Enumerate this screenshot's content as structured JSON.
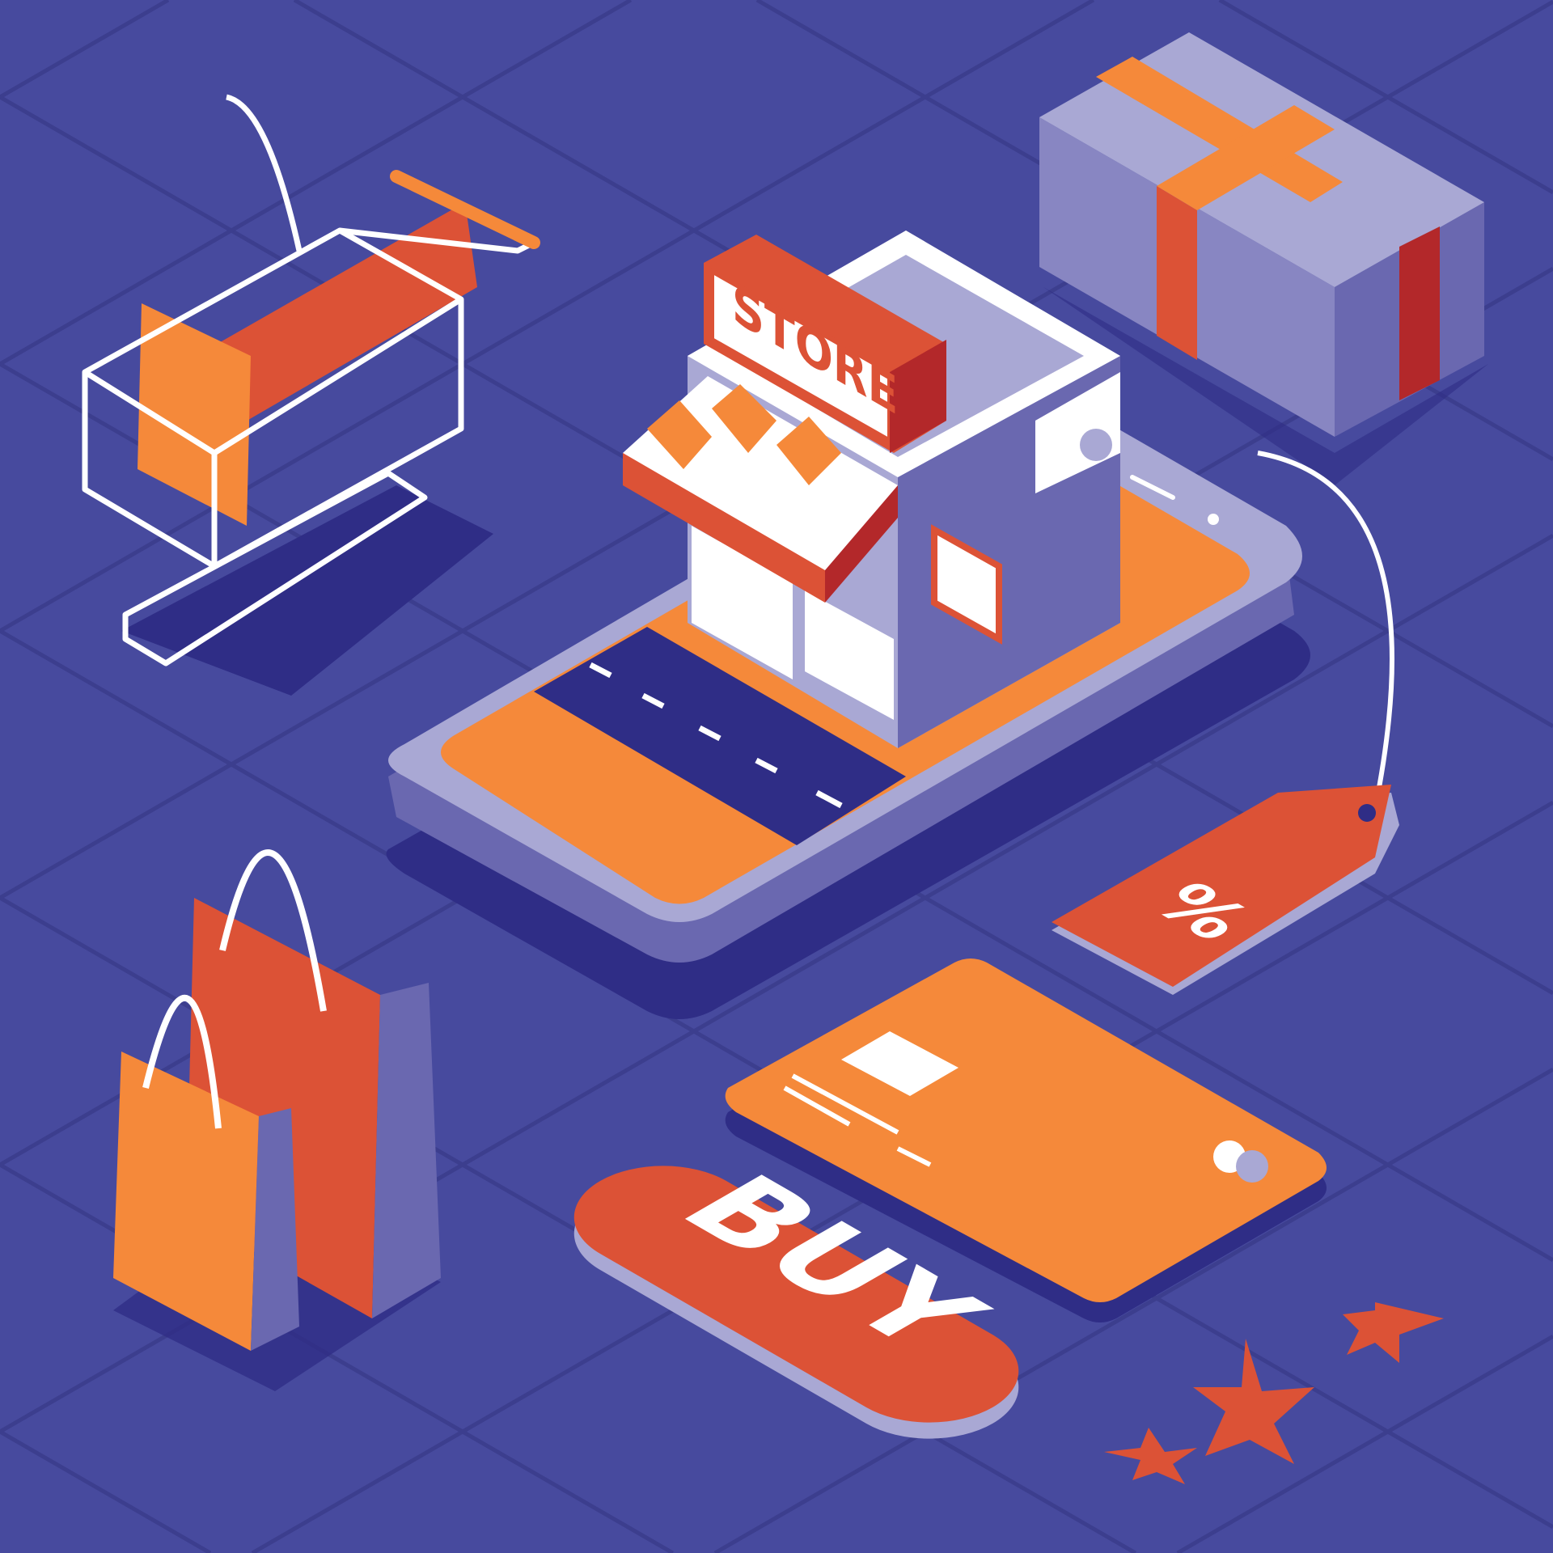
{
  "scene": {
    "store_sign": "STORE",
    "buy_button": "BUY",
    "discount_tag": "%"
  },
  "colors": {
    "background": "#474a9e",
    "grid": "#3c3e8e",
    "shadow": "#2f2d86",
    "orange": "#f5893a",
    "red_orange": "#dc5236",
    "dark_red": "#b3282a",
    "lavender": "#a9a8d4",
    "purple": "#6a68b0",
    "white": "#ffffff"
  },
  "icons": [
    "shopping-cart-icon",
    "shopping-bag-icon",
    "store-icon",
    "package-icon",
    "price-tag-icon",
    "credit-card-icon",
    "star-icon",
    "smartphone-icon"
  ]
}
